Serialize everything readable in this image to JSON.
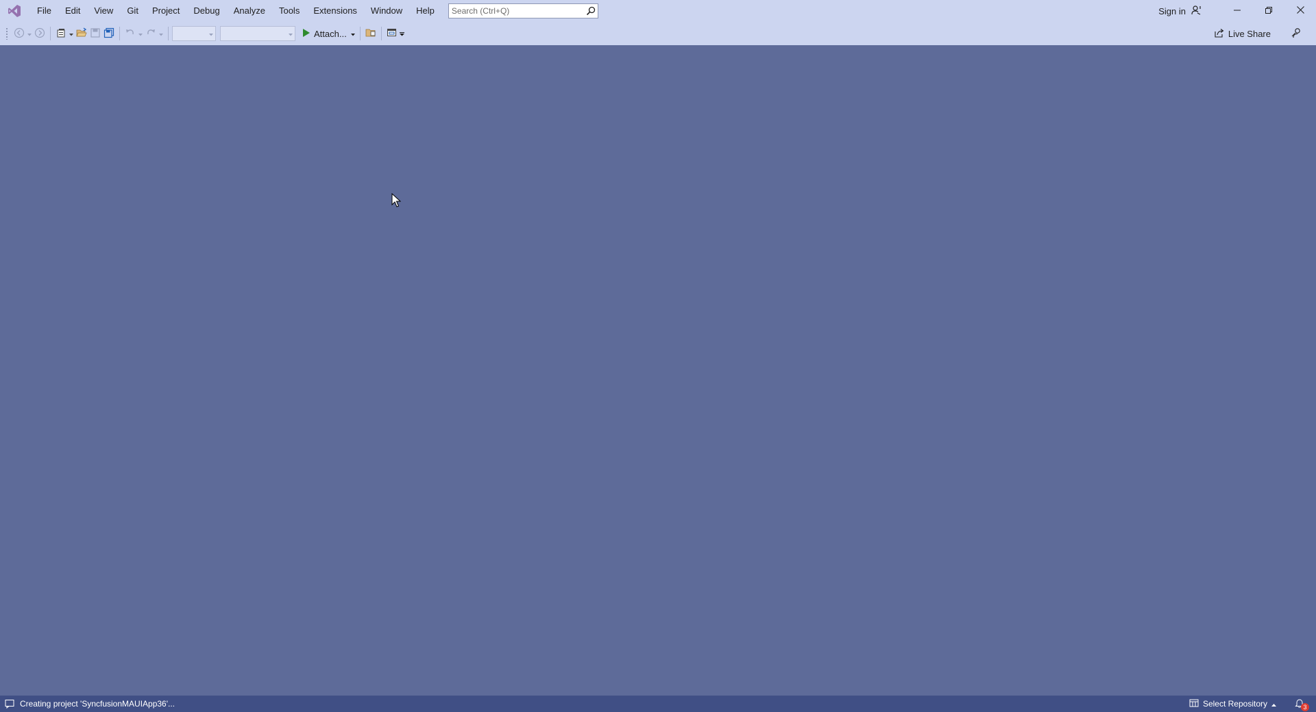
{
  "menu": [
    "File",
    "Edit",
    "View",
    "Git",
    "Project",
    "Debug",
    "Analyze",
    "Tools",
    "Extensions",
    "Window",
    "Help"
  ],
  "search": {
    "placeholder": "Search (Ctrl+Q)",
    "icon": "search-icon"
  },
  "account": {
    "sign_in_label": "Sign in",
    "icon": "account-person-icon"
  },
  "window_controls": {
    "minimize_icon": "minimize-icon",
    "restore_icon": "restore-icon",
    "close_icon": "close-icon"
  },
  "toolbar": {
    "attach_label": "Attach...",
    "live_share_label": "Live Share",
    "solution_config_value": "",
    "solution_platform_value": ""
  },
  "status": {
    "message": "Creating project 'SyncfusionMAUIApp36'...",
    "repository_label": "Select Repository",
    "notification_count": "3"
  },
  "colors": {
    "chrome": "#ccd5f0",
    "workspace": "#5e6b99",
    "statusbar": "#404f85",
    "play_green": "#2e8b2e"
  }
}
